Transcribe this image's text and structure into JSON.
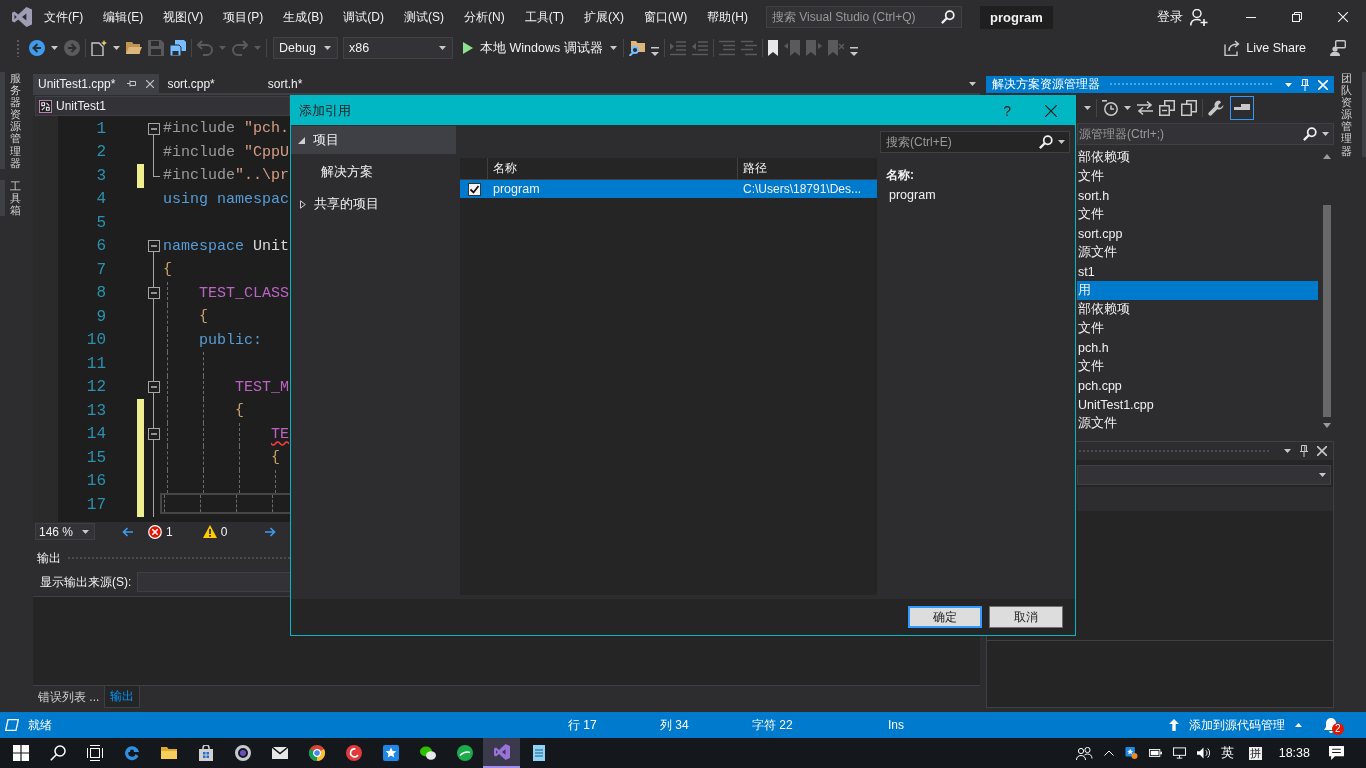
{
  "title_bar": {
    "menus": [
      "文件(F)",
      "编辑(E)",
      "视图(V)",
      "项目(P)",
      "生成(B)",
      "调试(D)",
      "测试(S)",
      "分析(N)",
      "工具(T)",
      "扩展(X)",
      "窗口(W)",
      "帮助(H)"
    ],
    "search": {
      "placeholder": "搜索 Visual Studio (Ctrl+Q)"
    },
    "solution_name": "program",
    "sign_in": "登录"
  },
  "toolbar": {
    "left_groups": [
      [
        {
          "kind": "back",
          "disabled": false
        },
        {
          "kind": "caret",
          "disabled": false
        },
        {
          "kind": "forward",
          "disabled": true
        }
      ],
      [
        {
          "kind": "new_item",
          "disabled": false
        },
        {
          "kind": "caret",
          "disabled": false
        },
        {
          "kind": "open",
          "disabled": false
        },
        {
          "kind": "save",
          "disabled": true
        },
        {
          "kind": "save_all",
          "disabled": false
        }
      ],
      [
        {
          "kind": "undo",
          "disabled": true
        },
        {
          "kind": "caret",
          "disabled": true
        },
        {
          "kind": "redo",
          "disabled": true
        },
        {
          "kind": "caret",
          "disabled": true
        }
      ]
    ],
    "configuration": "Debug",
    "platform": "x86",
    "run_target": "本地 Windows 调试器",
    "right_groups": [
      [
        {
          "kind": "find",
          "disabled": false
        },
        {
          "kind": "overflow",
          "disabled": false
        }
      ],
      [
        {
          "kind": "indent",
          "disabled": true
        },
        {
          "kind": "outdent",
          "disabled": true
        }
      ],
      [
        {
          "kind": "comment",
          "disabled": true
        },
        {
          "kind": "uncomment",
          "disabled": true
        }
      ],
      [
        {
          "kind": "bookmark",
          "disabled": false
        },
        {
          "kind": "prev_bookmark",
          "disabled": true
        },
        {
          "kind": "next_bookmark",
          "disabled": true
        },
        {
          "kind": "clear_bookmarks",
          "disabled": true
        },
        {
          "kind": "overflow",
          "disabled": false
        }
      ]
    ],
    "live_share": "Live Share"
  },
  "left_strip": [
    "服务器资源管理器",
    "工具箱"
  ],
  "editor": {
    "tabs": [
      {
        "label": "UnitTest1.cpp*",
        "selected": true
      },
      {
        "label": "sort.cpp*",
        "selected": false
      },
      {
        "label": "sort.h*",
        "selected": false
      }
    ],
    "scope": "UnitTest1",
    "lines": [
      {
        "number": "1",
        "kind": "fold_start",
        "changed": false,
        "current": false,
        "tokens": [
          {
            "kind": "preprocessor",
            "text": "#include ",
            "error": false
          },
          {
            "kind": "string",
            "text": "\"pch.",
            "error": false
          }
        ]
      },
      {
        "number": "2",
        "kind": "fold_line",
        "changed": false,
        "current": false,
        "tokens": [
          {
            "kind": "preprocessor",
            "text": "#include ",
            "error": false
          },
          {
            "kind": "string",
            "text": "\"CppU",
            "error": false
          }
        ]
      },
      {
        "number": "3",
        "kind": "fold_end",
        "changed": true,
        "current": false,
        "tokens": [
          {
            "kind": "preprocessor",
            "text": "#include",
            "error": false
          },
          {
            "kind": "string",
            "text": "\"..\\pr",
            "error": false
          }
        ]
      },
      {
        "number": "4",
        "kind": "plain",
        "changed": false,
        "current": false,
        "tokens": [
          {
            "kind": "keyword",
            "text": "using namespac",
            "error": false
          }
        ]
      },
      {
        "number": "5",
        "kind": "plain",
        "changed": false,
        "current": false
      },
      {
        "number": "6",
        "kind": "fold_start",
        "changed": false,
        "current": false,
        "tokens": [
          {
            "kind": "keyword",
            "text": "namespace ",
            "error": false
          },
          {
            "kind": "identifier",
            "text": "Unit",
            "error": false
          }
        ]
      },
      {
        "number": "7",
        "kind": "fold_line",
        "changed": false,
        "current": false,
        "tokens": [
          {
            "kind": "brace",
            "text": "{",
            "error": false
          }
        ],
        "children": [
          {
            "number": "8",
            "kind": "fold_start",
            "changed": false,
            "current": false,
            "tokens": [
              {
                "kind": "macro",
                "text": "TEST_CLASS",
                "error": false
              }
            ]
          },
          {
            "number": "9",
            "kind": "fold_line",
            "changed": false,
            "current": false,
            "tokens": [
              {
                "kind": "brace",
                "text": "{",
                "error": false
              }
            ]
          },
          {
            "number": "10",
            "kind": "fold_line",
            "changed": false,
            "current": false,
            "tokens": [
              {
                "kind": "keyword",
                "text": "public:",
                "error": false
              }
            ],
            "children": [
              {
                "number": "11",
                "kind": "fold_line",
                "changed": false,
                "current": false
              },
              {
                "number": "12",
                "kind": "fold_start",
                "changed": false,
                "current": false,
                "tokens": [
                  {
                    "kind": "macro",
                    "text": "TEST_M",
                    "error": false
                  }
                ]
              },
              {
                "number": "13",
                "kind": "fold_line",
                "changed": true,
                "current": false,
                "tokens": [
                  {
                    "kind": "brace",
                    "text": "{",
                    "error": false
                  }
                ],
                "children": [
                  {
                    "number": "14",
                    "kind": "fold_start",
                    "changed": true,
                    "current": false,
                    "tokens": [
                      {
                        "kind": "macro",
                        "text": "TE",
                        "error": true
                      }
                    ]
                  },
                  {
                    "number": "15",
                    "kind": "fold_line",
                    "changed": true,
                    "current": false,
                    "tokens": [
                      {
                        "kind": "brace",
                        "text": "{",
                        "error": false
                      }
                    ]
                  },
                  {
                    "number": "16",
                    "kind": "fold_line",
                    "changed": true,
                    "current": false
                  },
                  {
                    "number": "17",
                    "kind": "fold_line",
                    "changed": true,
                    "current": true
                  }
                ]
              }
            ]
          }
        ]
      }
    ],
    "zoom": "146 %",
    "errors": "1",
    "warnings": "0"
  },
  "output": {
    "title": "输出",
    "source_label": "显示输出来源(S):",
    "tabs": [
      {
        "label": "错误列表 ...",
        "selected": false
      },
      {
        "label": "输出",
        "selected": true
      }
    ]
  },
  "solution_explorer": {
    "title": "解决方案资源管理器",
    "toolbar": [
      [
        {
          "kind": "caret",
          "on": false
        }
      ],
      [
        {
          "kind": "history",
          "on": false
        },
        {
          "kind": "caret",
          "on": false
        },
        {
          "kind": "sync",
          "on": false
        },
        {
          "kind": "collapse",
          "on": false
        },
        {
          "kind": "copy",
          "on": false
        }
      ],
      [
        {
          "kind": "wrench",
          "on": false
        },
        {
          "kind": "preview",
          "on": true
        }
      ]
    ],
    "search": {
      "placeholder": "源管理器(Ctrl+;)"
    },
    "items": [
      {
        "label": "部依赖项",
        "selected": false
      },
      {
        "label": "文件",
        "selected": false
      },
      {
        "label": "sort.h",
        "selected": false
      },
      {
        "label": "文件",
        "selected": false
      },
      {
        "label": "sort.cpp",
        "selected": false
      },
      {
        "label": "源文件",
        "selected": false
      },
      {
        "label": "st1",
        "selected": false
      },
      {
        "label": "用",
        "selected": true
      },
      {
        "label": "部依赖项",
        "selected": false
      },
      {
        "label": "文件",
        "selected": false
      },
      {
        "label": "pch.h",
        "selected": false
      },
      {
        "label": "文件",
        "selected": false
      },
      {
        "label": "pch.cpp",
        "selected": false
      },
      {
        "label": "UnitTest1.cpp",
        "selected": false
      },
      {
        "label": "源文件",
        "selected": false
      }
    ]
  },
  "right_strip": [
    "团队资源管理器"
  ],
  "status_bar": {
    "state": "就绪",
    "line": "行 17",
    "column": "列 34",
    "character": "字符 22",
    "mode": "Ins",
    "source_control": "添加到源代码管理",
    "notifications": "2"
  },
  "taskbar": {
    "apps": [
      {
        "kind": "browser",
        "selected": false
      },
      {
        "kind": "folder",
        "selected": false
      },
      {
        "kind": "store",
        "selected": false
      },
      {
        "kind": "ring",
        "selected": false
      },
      {
        "kind": "mail",
        "selected": false
      },
      {
        "kind": "segmented",
        "selected": false
      },
      {
        "kind": "music",
        "selected": false
      },
      {
        "kind": "star",
        "selected": false
      },
      {
        "kind": "chat",
        "selected": false
      },
      {
        "kind": "ball",
        "selected": false
      },
      {
        "kind": "ribbon",
        "selected": true
      },
      {
        "kind": "notepad",
        "selected": false
      }
    ],
    "ime": "英",
    "ime_mode": "拼",
    "time": "18:38"
  },
  "dialog": {
    "title": "添加引用",
    "help": "?",
    "nav": [
      {
        "label": "项目",
        "selected": true,
        "expanded": true,
        "children": [
          {
            "label": "解决方案",
            "selected": false
          }
        ]
      },
      {
        "label": "共享的项目",
        "selected": false,
        "expanded": false
      }
    ],
    "search": {
      "placeholder": "搜索(Ctrl+E)"
    },
    "columns": [
      "名称",
      "路径"
    ],
    "rows": [
      {
        "name": "program",
        "path": "C:\\Users\\18791\\Des...",
        "checked": true,
        "selected": true
      }
    ],
    "detail": {
      "label": "名称:",
      "value": "program"
    },
    "buttons": [
      {
        "label": "确定",
        "default": true
      },
      {
        "label": "取消",
        "default": false
      }
    ]
  }
}
